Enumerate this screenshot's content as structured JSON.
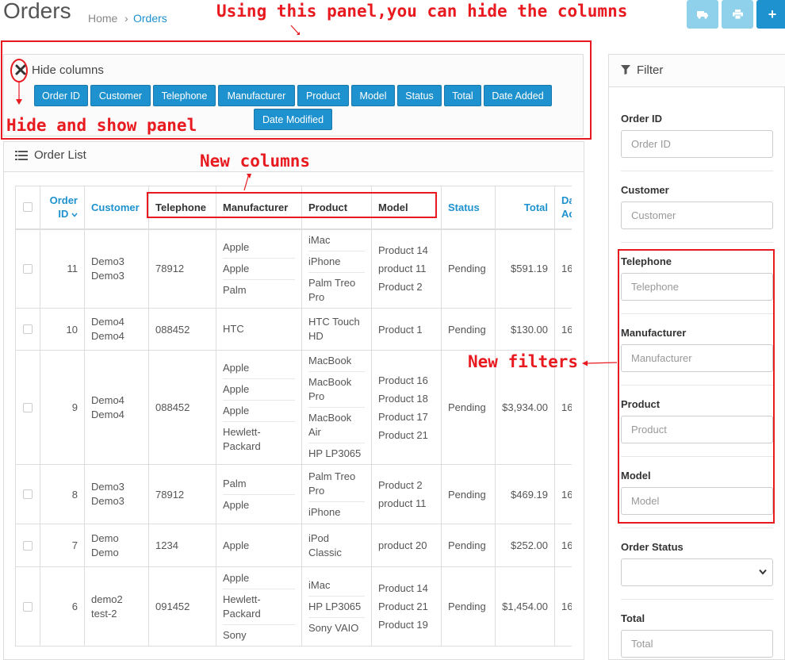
{
  "header": {
    "title": "Orders",
    "breadcrumb": {
      "home": "Home",
      "sep": "›",
      "current": "Orders"
    },
    "buttons": {
      "ship": "truck-icon",
      "print": "print-icon",
      "add": "+"
    }
  },
  "annotations": {
    "top": "Using this panel,you can hide the columns",
    "hide_panel": "Hide and show panel",
    "new_columns": "New columns",
    "new_filters": "New filters"
  },
  "hide_panel": {
    "title": "Hide columns",
    "buttons": [
      "Order ID",
      "Customer",
      "Telephone",
      "Manufacturer",
      "Product",
      "Model",
      "Status",
      "Total",
      "Date Added",
      "Date Modified"
    ]
  },
  "order_list": {
    "title": "Order List",
    "headers": {
      "order_id_1": "Order",
      "order_id_2": "ID",
      "customer": "Customer",
      "telephone": "Telephone",
      "manufacturer": "Manufacturer",
      "product": "Product",
      "model": "Model",
      "status": "Status",
      "total": "Total",
      "date_1": "Da",
      "date_2": "Ac"
    },
    "rows": [
      {
        "id": "11",
        "customer": [
          "Demo3",
          "Demo3"
        ],
        "telephone": "78912",
        "manufacturer": [
          "Apple",
          "Apple",
          "Palm"
        ],
        "product": [
          "iMac",
          "iPhone",
          "Palm Treo Pro"
        ],
        "model": [
          "Product 14",
          "product 11",
          "Product 2"
        ],
        "status": "Pending",
        "total": "$591.19",
        "date": "16"
      },
      {
        "id": "10",
        "customer": [
          "Demo4",
          "Demo4"
        ],
        "telephone": "088452",
        "manufacturer": [
          "HTC"
        ],
        "product": [
          "HTC Touch HD"
        ],
        "model": [
          "Product 1"
        ],
        "status": "Pending",
        "total": "$130.00",
        "date": "16"
      },
      {
        "id": "9",
        "customer": [
          "Demo4",
          "Demo4"
        ],
        "telephone": "088452",
        "manufacturer": [
          "Apple",
          "Apple",
          "Apple",
          "Hewlett-Packard"
        ],
        "product": [
          "MacBook",
          "MacBook Pro",
          "MacBook Air",
          "HP LP3065"
        ],
        "model": [
          "Product 16",
          "Product 18",
          "Product 17",
          "Product 21"
        ],
        "status": "Pending",
        "total": "$3,934.00",
        "date": "16"
      },
      {
        "id": "8",
        "customer": [
          "Demo3",
          "Demo3"
        ],
        "telephone": "78912",
        "manufacturer": [
          "Palm",
          "Apple"
        ],
        "product": [
          "Palm Treo Pro",
          "iPhone"
        ],
        "model": [
          "Product 2",
          "product 11"
        ],
        "status": "Pending",
        "total": "$469.19",
        "date": "16"
      },
      {
        "id": "7",
        "customer": [
          "Demo",
          "Demo"
        ],
        "telephone": "1234",
        "manufacturer": [
          "Apple"
        ],
        "product": [
          "iPod Classic"
        ],
        "model": [
          "product 20"
        ],
        "status": "Pending",
        "total": "$252.00",
        "date": "16"
      },
      {
        "id": "6",
        "customer": [
          "demo2",
          "test-2"
        ],
        "telephone": "091452",
        "manufacturer": [
          "Apple",
          "Hewlett-Packard",
          "Sony"
        ],
        "product": [
          "iMac",
          "HP LP3065",
          "Sony VAIO"
        ],
        "model": [
          "Product 14",
          "Product 21",
          "Product 19"
        ],
        "status": "Pending",
        "total": "$1,454.00",
        "date": "16"
      }
    ]
  },
  "filter": {
    "title": "Filter",
    "order_id": {
      "label": "Order ID",
      "placeholder": "Order ID"
    },
    "customer": {
      "label": "Customer",
      "placeholder": "Customer"
    },
    "telephone": {
      "label": "Telephone",
      "placeholder": "Telephone"
    },
    "manufacturer": {
      "label": "Manufacturer",
      "placeholder": "Manufacturer"
    },
    "product": {
      "label": "Product",
      "placeholder": "Product"
    },
    "model": {
      "label": "Model",
      "placeholder": "Model"
    },
    "order_status": {
      "label": "Order Status",
      "value": ""
    },
    "total": {
      "label": "Total",
      "placeholder": "Total"
    }
  },
  "colors": {
    "accent": "#1e91cf",
    "annotation": "#e8191f",
    "disabled_button": "#8fd1eb"
  }
}
